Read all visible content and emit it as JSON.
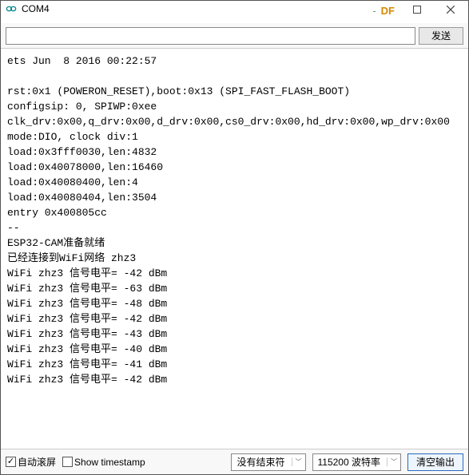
{
  "window": {
    "title": "COM4",
    "df_badge": "DF",
    "minus": "-"
  },
  "toolbar": {
    "input_value": "",
    "send_label": "发送"
  },
  "terminal": {
    "lines": [
      "ets Jun  8 2016 00:22:57",
      "",
      "rst:0x1 (POWERON_RESET),boot:0x13 (SPI_FAST_FLASH_BOOT)",
      "configsip: 0, SPIWP:0xee",
      "clk_drv:0x00,q_drv:0x00,d_drv:0x00,cs0_drv:0x00,hd_drv:0x00,wp_drv:0x00",
      "mode:DIO, clock div:1",
      "load:0x3fff0030,len:4832",
      "load:0x40078000,len:16460",
      "load:0x40080400,len:4",
      "load:0x40080404,len:3504",
      "entry 0x400805cc",
      "--",
      "ESP32-CAM准备就绪",
      "已经连接到WiFi网络 zhz3",
      "WiFi zhz3 信号电平= -42 dBm",
      "WiFi zhz3 信号电平= -63 dBm",
      "WiFi zhz3 信号电平= -48 dBm",
      "WiFi zhz3 信号电平= -42 dBm",
      "WiFi zhz3 信号电平= -43 dBm",
      "WiFi zhz3 信号电平= -40 dBm",
      "WiFi zhz3 信号电平= -41 dBm",
      "WiFi zhz3 信号电平= -42 dBm"
    ]
  },
  "statusbar": {
    "autoscroll_label": "自动滚屏",
    "autoscroll_checked": true,
    "timestamp_label": "Show timestamp",
    "timestamp_checked": false,
    "line_ending_selected": "没有结束符",
    "baud_selected": "115200 波特率",
    "clear_label": "清空输出"
  }
}
